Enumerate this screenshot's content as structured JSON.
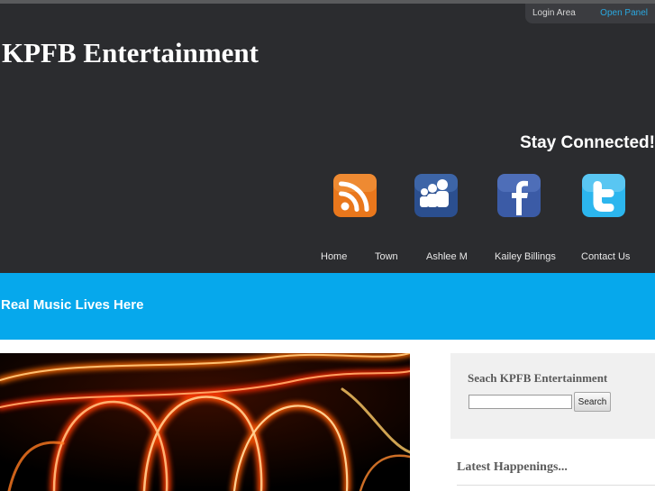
{
  "site": {
    "title": "KPFB Entertainment",
    "tagline": "Real Music Lives Here"
  },
  "login_panel": {
    "label": "Login Area",
    "open_link": "Open Panel"
  },
  "social": {
    "heading": "Stay Connected!",
    "icons": [
      "rss-icon",
      "myspace-icon",
      "facebook-icon",
      "twitter-icon"
    ]
  },
  "nav": {
    "items": [
      "Home",
      "Town",
      "Ashlee M",
      "Kailey Billings",
      "Contact Us"
    ]
  },
  "sidebar": {
    "search": {
      "title": "Seach KPFB Entertainment",
      "input_value": "",
      "button_label": "Search"
    },
    "happenings": {
      "title": "Latest Happenings..."
    }
  },
  "colors": {
    "header_bg": "#2b2c2f",
    "banner_bg": "#06a8ec",
    "link_accent": "#2aa8e0"
  }
}
